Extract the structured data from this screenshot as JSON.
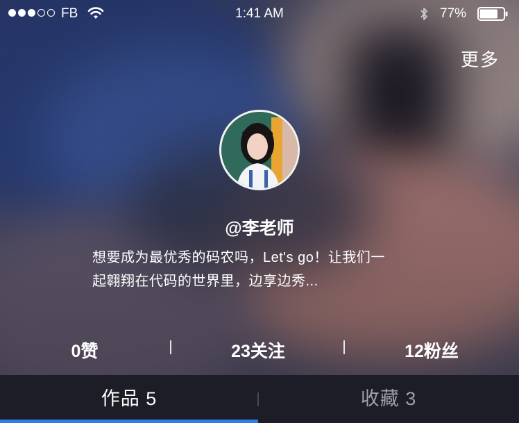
{
  "status_bar": {
    "signal_full": 3,
    "signal_total": 5,
    "carrier": "FB",
    "time": "1:41 AM",
    "battery_percent": "77%",
    "battery_level": 0.77
  },
  "header": {
    "more_label": "更多"
  },
  "profile": {
    "username": "@李老师",
    "bio_line1": "想要成为最优秀的码农吗，Let's go！让我们一",
    "bio_line2": "起翱翔在代码的世界里，边享边秀..."
  },
  "stats": [
    {
      "label": "0赞"
    },
    {
      "label": "23关注"
    },
    {
      "label": "12粉丝"
    }
  ],
  "tabs": [
    {
      "label": "作品 5",
      "active": true
    },
    {
      "label": "收藏 3",
      "active": false
    }
  ],
  "colors": {
    "tab_bar_bg": "#1c1d26",
    "active_indicator": "#2f7de6",
    "inactive_tab_text": "#9ea0ab"
  },
  "icons": {
    "wifi": "wifi-icon",
    "bluetooth": "bluetooth-icon",
    "battery": "battery-icon"
  }
}
